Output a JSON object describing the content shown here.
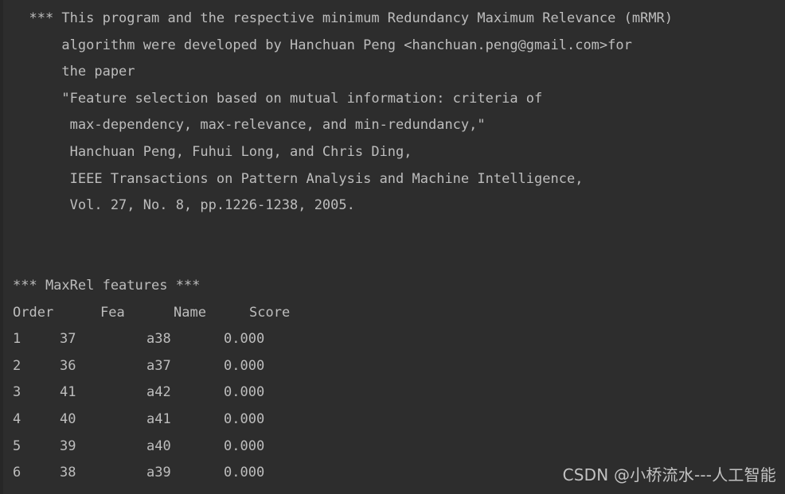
{
  "terminal": {
    "background_color": "#2d2d2d",
    "text_color": "#bdbdbd",
    "gutter_color": "#272727"
  },
  "banner": {
    "lines": [
      "  *** This program and the respective minimum Redundancy Maximum Relevance (mRMR)",
      "      algorithm were developed by Hanchuan Peng <hanchuan.peng@gmail.com>for",
      "      the paper",
      "      \"Feature selection based on mutual information: criteria of",
      "       max-dependency, max-relevance, and min-redundancy,\"",
      "       Hanchuan Peng, Fuhui Long, and Chris Ding,",
      "       IEEE Transactions on Pattern Analysis and Machine Intelligence,",
      "       Vol. 27, No. 8, pp.1226-1238, 2005."
    ]
  },
  "maxrel": {
    "section_title": "*** MaxRel features ***",
    "columns": [
      "Order",
      "Fea",
      "Name",
      "Score"
    ],
    "rows": [
      {
        "order": "1",
        "fea": "37",
        "name": "a38",
        "score": "0.000"
      },
      {
        "order": "2",
        "fea": "36",
        "name": "a37",
        "score": "0.000"
      },
      {
        "order": "3",
        "fea": "41",
        "name": "a42",
        "score": "0.000"
      },
      {
        "order": "4",
        "fea": "40",
        "name": "a41",
        "score": "0.000"
      },
      {
        "order": "5",
        "fea": "39",
        "name": "a40",
        "score": "0.000"
      },
      {
        "order": "6",
        "fea": "38",
        "name": "a39",
        "score": "0.000"
      }
    ]
  },
  "watermark": {
    "text": "CSDN @小桥流水---人工智能"
  }
}
